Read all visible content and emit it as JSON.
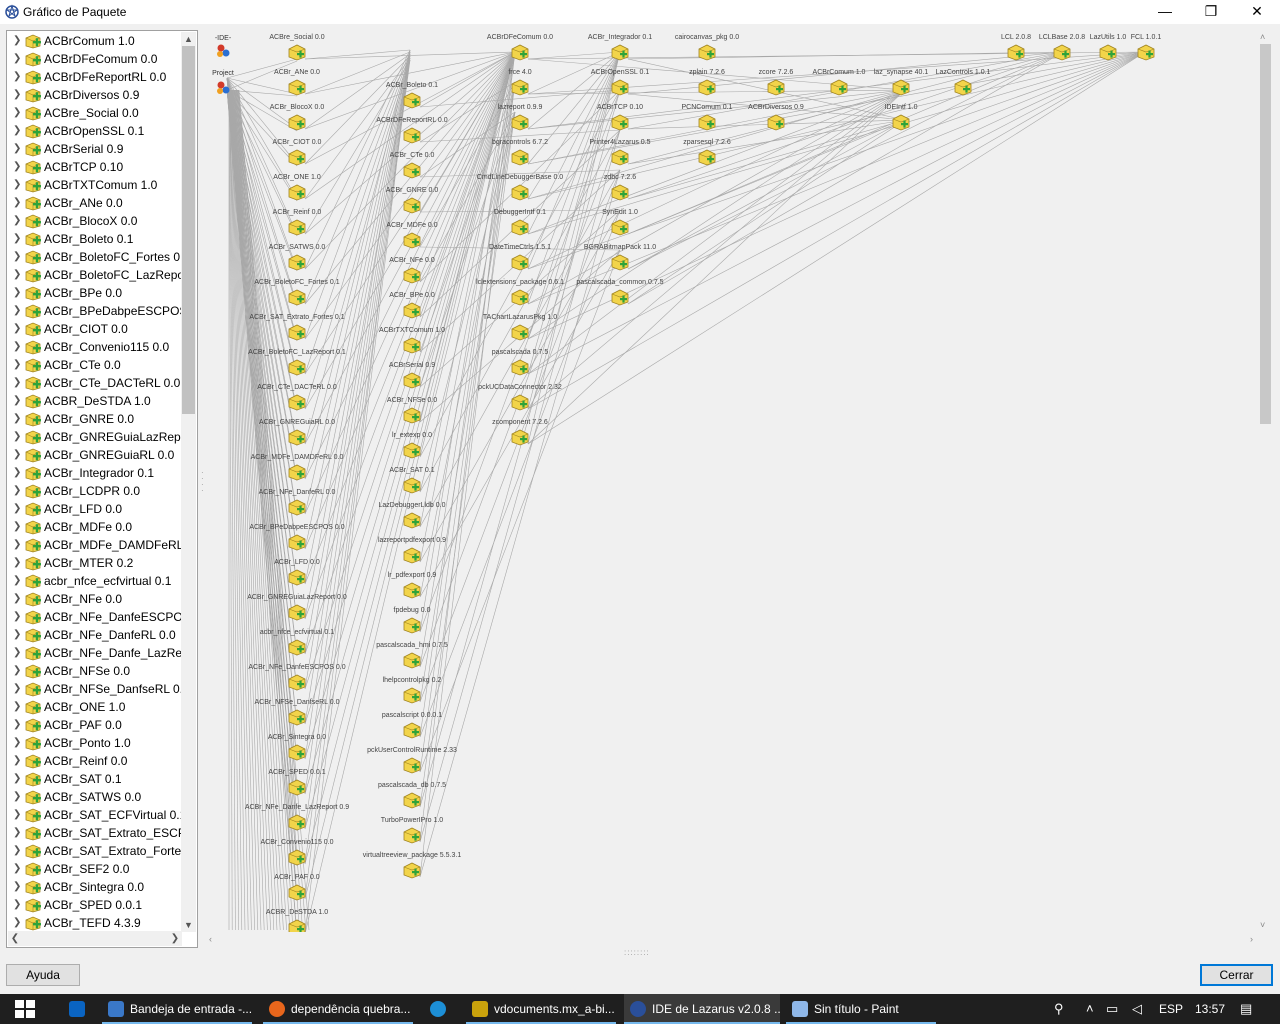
{
  "window": {
    "title": "Gráfico de Paquete",
    "minimize": "—",
    "maximize": "❐",
    "close": "✕"
  },
  "package_list": [
    "ACBrComum 1.0",
    "ACBrDFeComum 0.0",
    "ACBrDFeReportRL 0.0",
    "ACBrDiversos 0.9",
    "ACBre_Social 0.0",
    "ACBrOpenSSL 0.1",
    "ACBrSerial 0.9",
    "ACBrTCP 0.10",
    "ACBrTXTComum 1.0",
    "ACBr_ANe 0.0",
    "ACBr_BlocoX 0.0",
    "ACBr_Boleto 0.1",
    "ACBr_BoletoFC_Fortes 0.1",
    "ACBr_BoletoFC_LazReport",
    "ACBr_BPe 0.0",
    "ACBr_BPeDabpeESCPOS 0",
    "ACBr_CIOT 0.0",
    "ACBr_Convenio115 0.0",
    "ACBr_CTe 0.0",
    "ACBr_CTe_DACTeRL 0.0",
    "ACBR_DeSTDA 1.0",
    "ACBr_GNRE 0.0",
    "ACBr_GNREGuiaLazReport",
    "ACBr_GNREGuiaRL 0.0",
    "ACBr_Integrador 0.1",
    "ACBr_LCDPR 0.0",
    "ACBr_LFD 0.0",
    "ACBr_MDFe 0.0",
    "ACBr_MDFe_DAMDFeRL 0",
    "ACBr_MTER 0.2",
    "acbr_nfce_ecfvirtual 0.1",
    "ACBr_NFe 0.0",
    "ACBr_NFe_DanfeESCPOS (",
    "ACBr_NFe_DanfeRL 0.0",
    "ACBr_NFe_Danfe_LazRepo",
    "ACBr_NFSe 0.0",
    "ACBr_NFSe_DanfseRL 0.0",
    "ACBr_ONE 1.0",
    "ACBr_PAF 0.0",
    "ACBr_Ponto 1.0",
    "ACBr_Reinf 0.0",
    "ACBr_SAT 0.1",
    "ACBr_SATWS 0.0",
    "ACBr_SAT_ECFVirtual 0.1",
    "ACBr_SAT_Extrato_ESCPOS",
    "ACBr_SAT_Extrato_Fortes (",
    "ACBr_SEF2 0.0",
    "ACBr_Sintegra 0.0",
    "ACBr_SPED 0.0.1",
    "ACBr_TEFD 4.3.9"
  ],
  "graph": {
    "root_nodes": [
      "-IDE-",
      "Project"
    ],
    "col1": [
      "ACBre_Social 0.0",
      "ACBr_ANe 0.0",
      "ACBr_BlocoX 0.0",
      "ACBr_CIOT 0.0",
      "ACBr_ONE 1.0",
      "ACBr_Reinf 0.0",
      "ACBr_SATWS 0.0",
      "ACBr_BoletoFC_Fortes 0.1",
      "ACBr_SAT_Extrato_Fortes 0.1",
      "ACBr_BoletoFC_LazReport 0.1",
      "ACBr_CTe_DACTeRL 0.0",
      "ACBr_GNREGuiaRL 0.0",
      "ACBr_MDFe_DAMDFeRL 0.0",
      "ACBr_NFe_DanfeRL 0.0",
      "ACBr_BPeDabpeESCPOS 0.0",
      "ACBr_LFD 0.0",
      "ACBr_GNREGuiaLazReport 0.0",
      "acbr_nfce_ecfvirtual 0.1",
      "ACBr_NFe_DanfeESCPOS 0.0",
      "ACBr_NFSe_DanfseRL 0.0",
      "ACBr_Sintegra 0.0",
      "ACBr_SPED 0.0.1",
      "ACBr_NFe_Danfe_LazReport 0.9",
      "ACBr_Convenio115 0.0",
      "ACBr_PAF 0.0",
      "ACBR_DeSTDA 1.0"
    ],
    "col2": [
      "ACBr_Boleto 0.1",
      "ACBrDFeReportRL 0.0",
      "ACBr_CTe 0.0",
      "ACBr_GNRE 0.0",
      "ACBr_MDFe 0.0",
      "ACBr_NFe 0.0",
      "ACBr_BPe 0.0",
      "ACBrTXTComum 1.0",
      "ACBrSerial 0.9",
      "ACBr_NFSe 0.0",
      "lr_extexp 0.0",
      "ACBr_SAT 0.1",
      "LazDebuggerLldb 0.0",
      "lazreportpdfexport 0.9",
      "lr_pdfexport 0.9",
      "fpdebug 0.0",
      "pascalscada_hmi 0.7.5",
      "lhelpcontrolpkg 0.2",
      "pascalscript 0.0.0.1",
      "pckUserControlRuntime 2.33",
      "pascalscada_db 0.7.5",
      "TurboPowerIPro 1.0",
      "virtualtreeview_package 5.5.3.1"
    ],
    "col3": [
      "ACBrDFeComum 0.0",
      "frce 4.0",
      "lazreport 0.9.9",
      "bgracontrols 6.7.2",
      "CmdLineDebuggerBase 0.0",
      "DebuggerIntf 0.1",
      "DateTimeCtrls 1.5.1",
      "lclextensions_package 0.6.1",
      "TAChartLazarusPkg 1.0",
      "pascalscada 0.7.5",
      "pckUCDataConnector 2.32",
      "zcomponent 7.2.6"
    ],
    "col4": [
      "ACBr_Integrador 0.1",
      "ACBrOpenSSL 0.1",
      "ACBrTCP 0.10",
      "Printer4Lazarus 0.5",
      "zdbc 7.2.6",
      "SynEdit 1.0",
      "BGRABitmapPack 11.0",
      "pascalscada_common 0.7.5"
    ],
    "col5": [
      "cairocanvas_pkg 0.0",
      "zplain 7.2.6",
      "PCNComum 0.1",
      "zparsesql 7.2.6"
    ],
    "col6": [
      "zcore 7.2.6",
      "ACBrDiversos 0.9"
    ],
    "col7": [
      "ACBrComum 1.0"
    ],
    "col8": [
      "laz_synapse 40.1",
      "IDEIntf 1.0"
    ],
    "col9": [
      "LazControls 1.0.1"
    ],
    "top_right": [
      "LCL 2.0.8",
      "LCLBase 2.0.8",
      "LazUtils 1.0",
      "FCL 1.0.1"
    ]
  },
  "buttons": {
    "help": "Ayuda",
    "close": "Cerrar"
  },
  "taskbar": {
    "items": [
      "Bandeja de entrada -...",
      "dependência quebra...",
      "vdocuments.mx_a-bi...",
      "IDE de Lazarus v2.0.8 ...",
      "Sin título - Paint"
    ],
    "lang": "ESP",
    "time": "13:57"
  },
  "colors": {
    "pkg_yellow": "#f2d44a",
    "pkg_green": "#2fa33a",
    "accent": "#0078d7",
    "taskbar": "#1f1f1f"
  }
}
